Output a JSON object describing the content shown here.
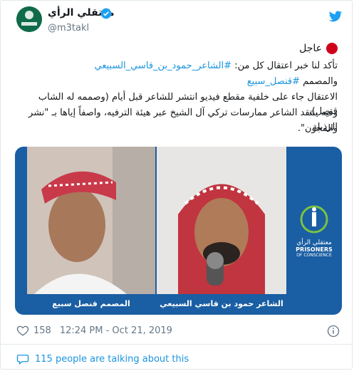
{
  "tweet": {
    "author_name": "معتقلي الرأي",
    "author_handle": "@m3takl",
    "avatar_text": "معتقلي الرأي",
    "breaking_label": "عاجل",
    "line1_text": "تأكد لنا خبر اعتقال كل من: ",
    "line1_hashtag": "#الشاعر_حمود_بن_قاسي_السبيعي",
    "line2_text": "والمصمم ",
    "line2_hashtag": "#قنصل_سبيع",
    "line3": "الاعتقال جاء على خلفية مقطع فيديو انتشر للشاعر قبل أيام (وصممه له الشاب قنصل)،",
    "line4": "وفيه ينتقد الشاعر ممارسات تركي آل الشيخ عبر هيئة الترفيه، واصفاً إياها بـ \"نشر الرذيلة",
    "line5": "والمجون\".",
    "caption_right": "الشاعر حمود بن قاسي السبيعي",
    "caption_left": "المصمم قنصل سبيع",
    "logo_ar": "معتقلي الرأي",
    "logo_en1": "PRISONERS",
    "logo_en2": "OF CONSCIENCE",
    "likes": "158",
    "timestamp": "12:24 PM - Oct 21, 2019",
    "talking": "115 people are talking about this"
  },
  "colors": {
    "link": "#1b95e0",
    "media_bg": "#1a5ea3",
    "breaking": "#d0021b"
  }
}
